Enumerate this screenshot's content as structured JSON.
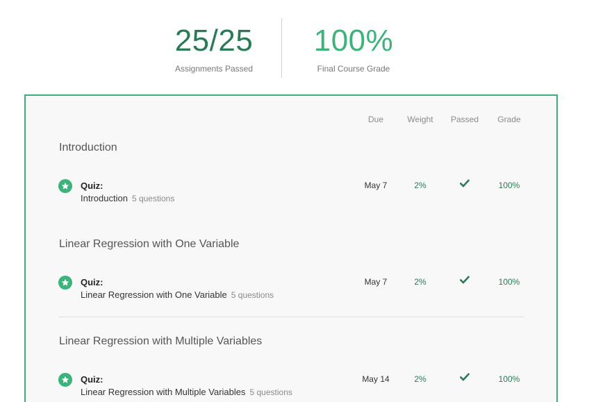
{
  "summary": {
    "assignments_value": "25/25",
    "assignments_label": "Assignments Passed",
    "grade_value": "100%",
    "grade_label": "Final Course Grade"
  },
  "columns": {
    "due": "Due",
    "weight": "Weight",
    "passed": "Passed",
    "grade": "Grade"
  },
  "colors": {
    "accent": "#3bb37a",
    "dark_green": "#2a7a55",
    "panel_border": "#3cae7b"
  },
  "sections": [
    {
      "title": "Introduction",
      "item": {
        "icon": "star-icon",
        "type": "Quiz:",
        "name": "Introduction",
        "count": "5 questions",
        "due": "May 7",
        "weight": "2%",
        "passed": "checkmark-icon",
        "grade": "100%"
      }
    },
    {
      "title": "Linear Regression with One Variable",
      "item": {
        "icon": "star-icon",
        "type": "Quiz:",
        "name": "Linear Regression with One Variable",
        "count": "5 questions",
        "due": "May 7",
        "weight": "2%",
        "passed": "checkmark-icon",
        "grade": "100%"
      }
    },
    {
      "title": "Linear Regression with Multiple Variables",
      "item": {
        "icon": "star-icon",
        "type": "Quiz:",
        "name": "Linear Regression with Multiple Variables",
        "count": "5 questions",
        "due": "May 14",
        "weight": "2%",
        "passed": "checkmark-icon",
        "grade": "100%"
      }
    }
  ]
}
